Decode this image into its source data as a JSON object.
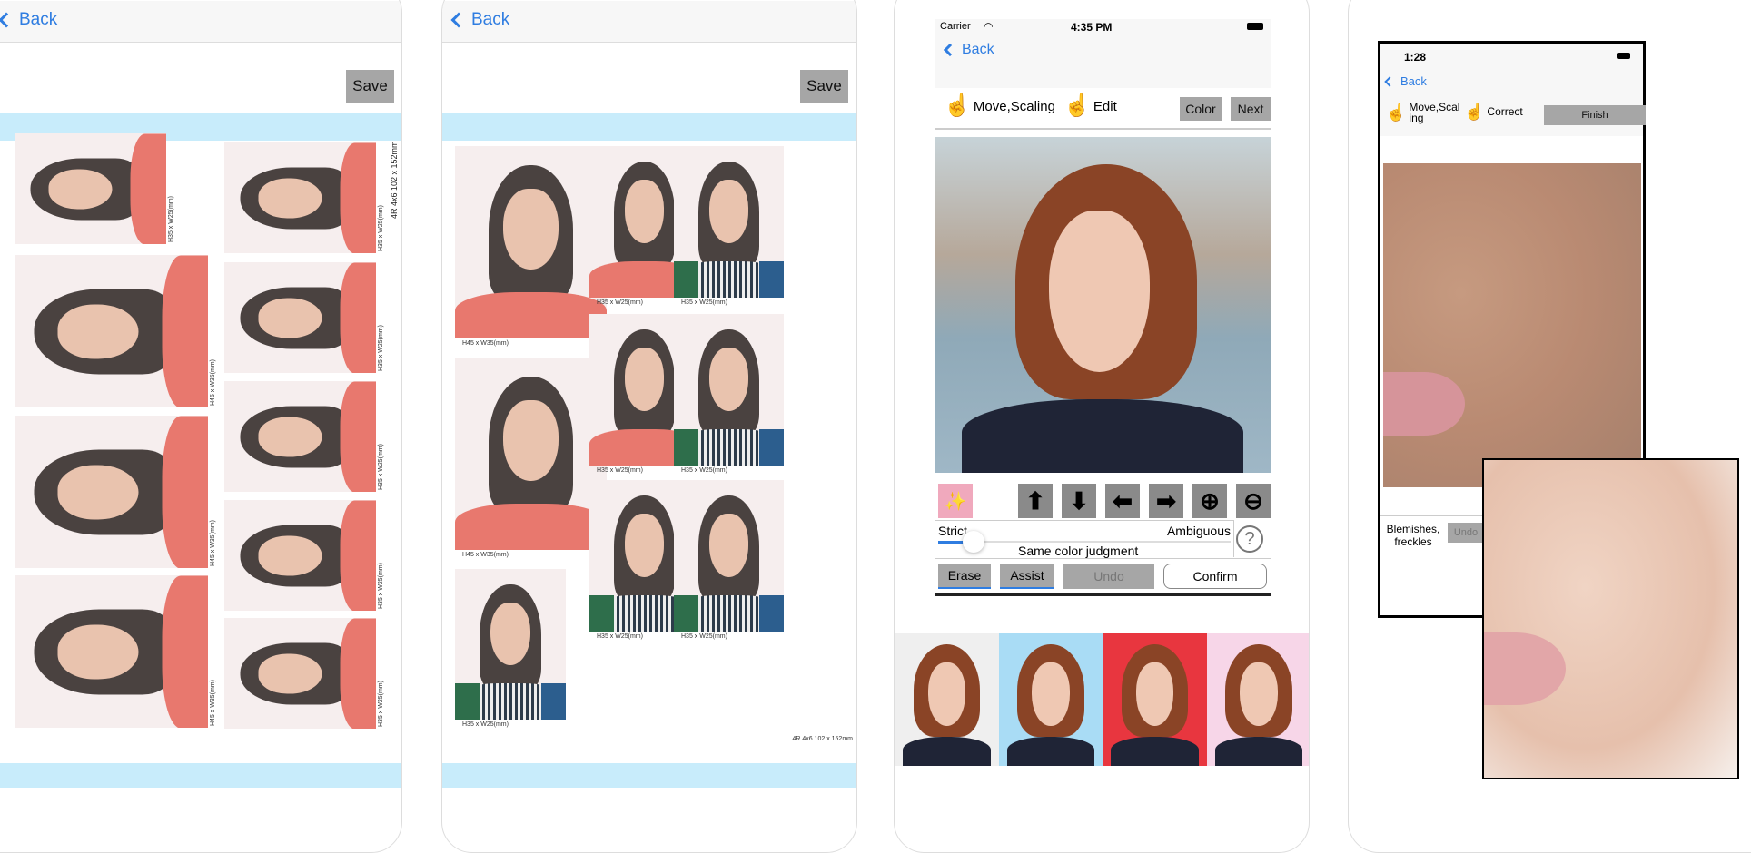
{
  "panel1": {
    "back_label": "Back",
    "save_label": "Save",
    "sheet_size_label": "4R 4x6 102 x 152mm",
    "photos": [
      {
        "label": "H35 x W25(mm)",
        "style": "pink"
      },
      {
        "label": "H45 x W35(mm)",
        "style": "pink"
      },
      {
        "label": "H45 x W35(mm)",
        "style": "pink"
      },
      {
        "label": "H45 x W35(mm)",
        "style": "pink"
      },
      {
        "label": "H35 x W25(mm)",
        "style": "pink"
      },
      {
        "label": "H35 x W25(mm)",
        "style": "pink"
      },
      {
        "label": "H35 x W25(mm)",
        "style": "pink"
      },
      {
        "label": "H35 x W25(mm)",
        "style": "pink"
      },
      {
        "label": "H35 x W25(mm)",
        "style": "pink"
      }
    ]
  },
  "panel2": {
    "back_label": "Back",
    "save_label": "Save",
    "sheet_size_label": "4R 4x6 102 x 152mm",
    "photos": [
      {
        "label": "H45 x W35(mm)",
        "style": "pink"
      },
      {
        "label": "H45 x W35(mm)",
        "style": "pink"
      },
      {
        "label": "H35 x W25(mm)",
        "style": "striped"
      },
      {
        "label": "H35 x W25(mm)",
        "style": "pink"
      },
      {
        "label": "H35 x W25(mm)",
        "style": "pink"
      },
      {
        "label": "H35 x W25(mm)",
        "style": "striped"
      },
      {
        "label": "H35 x W25(mm)",
        "style": "striped"
      },
      {
        "label": "H35 x W25(mm)",
        "style": "striped"
      },
      {
        "label": "H35 x W25(mm)",
        "style": "striped"
      }
    ]
  },
  "panel3": {
    "status": {
      "carrier": "Carrier",
      "time": "4:35 PM"
    },
    "back_label": "Back",
    "tool_move": "Move,Scaling",
    "tool_edit": "Edit",
    "color_label": "Color",
    "next_label": "Next",
    "controls": [
      "magic-wand",
      "arrow-up",
      "arrow-down",
      "arrow-left",
      "arrow-right",
      "zoom-in",
      "zoom-out"
    ],
    "slider": {
      "left_label": "Strict",
      "right_label": "Ambiguous",
      "caption": "Same color judgment",
      "value_percent": 12
    },
    "help_label": "?",
    "erase_label": "Erase",
    "assist_label": "Assist",
    "undo_label": "Undo",
    "confirm_label": "Confirm",
    "backgrounds": [
      "#efefef",
      "#a9dcf5",
      "#e8363f",
      "#f7d6e8"
    ]
  },
  "panel4": {
    "status": {
      "time": "1:28"
    },
    "back_label": "Back",
    "tool_move": "Move,Scal ing",
    "tool_correct": "Correct",
    "finish_label": "Finish",
    "mode_label": "Blemishes, freckles",
    "undo_label": "Undo"
  },
  "colors": {
    "accent": "#2f7de1",
    "button_gray": "#a6a6a6",
    "band_blue": "#c8ecfb"
  }
}
